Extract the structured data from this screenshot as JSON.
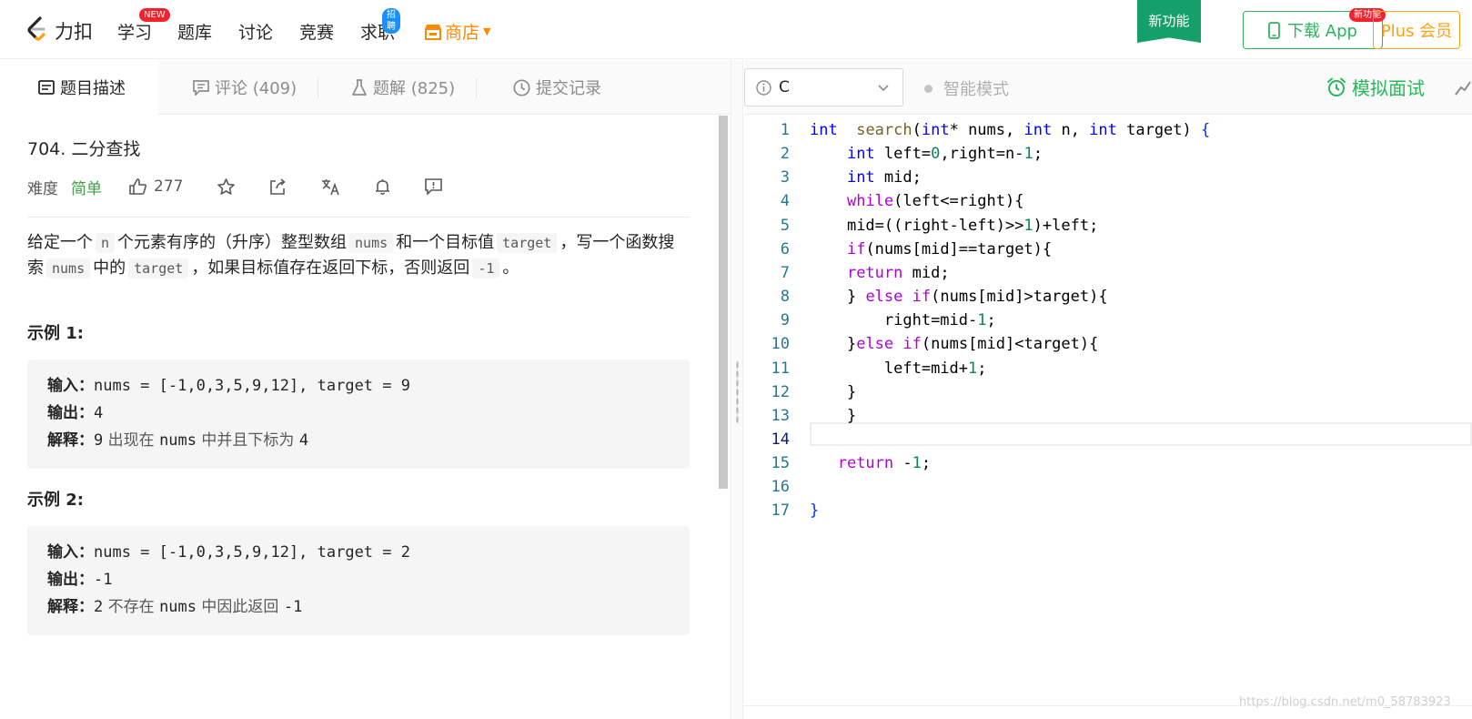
{
  "nav": {
    "logo_text": "力扣",
    "items": [
      {
        "label": "学习",
        "badge": "NEW"
      },
      {
        "label": "题库"
      },
      {
        "label": "讨论"
      },
      {
        "label": "竞赛"
      },
      {
        "label": "求职",
        "badge": "招聘"
      },
      {
        "label": "商店"
      }
    ],
    "new_feature_banner": "新功能",
    "download_label": "下载 App",
    "download_badge": "新功能",
    "plus_label": "Plus 会员"
  },
  "tabs": {
    "description": "题目描述",
    "comments": "评论 (409)",
    "solutions": "题解 (825)",
    "submissions": "提交记录"
  },
  "problem": {
    "title": "704. 二分查找",
    "difficulty_label": "难度",
    "difficulty": "简单",
    "likes": "277",
    "description": {
      "p1": "给定一个",
      "c1": "n",
      "p2": "个元素有序的（升序）整型数组",
      "c2": "nums",
      "p3": "和一个目标值",
      "c3": "target",
      "p4": "，写一个函数搜索",
      "c4": "nums",
      "p5": "中的",
      "c5": "target",
      "p6": "，如果目标值存在返回下标，否则返回",
      "c6": "-1",
      "p7": "。"
    },
    "examples": [
      {
        "title": "示例 1:",
        "input_label": "输入：",
        "input": "nums = [-1,0,3,5,9,12], target = 9",
        "output_label": "输出：",
        "output": "4",
        "explain_label": "解释：",
        "explain": [
          "9",
          " 出现在 ",
          "nums",
          " 中并且下标为 ",
          "4"
        ]
      },
      {
        "title": "示例 2:",
        "input_label": "输入：",
        "input": "nums = [-1,0,3,5,9,12], target = 2",
        "output_label": "输出：",
        "output": "-1",
        "explain_label": "解释：",
        "explain": [
          "2",
          " 不存在 ",
          "nums",
          " 中因此返回 ",
          "-1"
        ]
      }
    ]
  },
  "editor": {
    "language": "C",
    "smart_mode": "智能模式",
    "mock_interview": "模拟面试",
    "current_line": 14,
    "lines": [
      {
        "n": 1,
        "indent": "",
        "tokens": [
          [
            "kw",
            "int"
          ],
          [
            "",
            "  "
          ],
          [
            "fn",
            "search"
          ],
          [
            "",
            "("
          ],
          [
            "kw",
            "int"
          ],
          [
            "",
            "* nums, "
          ],
          [
            "kw",
            "int"
          ],
          [
            "",
            " n, "
          ],
          [
            "kw",
            "int"
          ],
          [
            "",
            " target) "
          ],
          [
            "par",
            "{"
          ]
        ]
      },
      {
        "n": 2,
        "indent": "    ",
        "tokens": [
          [
            "kw",
            "int"
          ],
          [
            "",
            " left="
          ],
          [
            "num",
            "0"
          ],
          [
            "",
            ",right=n-"
          ],
          [
            "num",
            "1"
          ],
          [
            "",
            ";"
          ]
        ]
      },
      {
        "n": 3,
        "indent": "    ",
        "tokens": [
          [
            "kw",
            "int"
          ],
          [
            "",
            " mid;"
          ]
        ]
      },
      {
        "n": 4,
        "indent": "    ",
        "tokens": [
          [
            "ctl",
            "while"
          ],
          [
            "",
            "(left<=right){"
          ]
        ]
      },
      {
        "n": 5,
        "indent": "    ",
        "tokens": [
          [
            "",
            "mid=((right-left)>>"
          ],
          [
            "num",
            "1"
          ],
          [
            "",
            ")+left;"
          ]
        ]
      },
      {
        "n": 6,
        "indent": "    ",
        "tokens": [
          [
            "ctl",
            "if"
          ],
          [
            "",
            "(nums[mid]==target){"
          ]
        ]
      },
      {
        "n": 7,
        "indent": "    ",
        "tokens": [
          [
            "ctl",
            "return"
          ],
          [
            "",
            " mid;"
          ]
        ]
      },
      {
        "n": 8,
        "indent": "    ",
        "tokens": [
          [
            "",
            "} "
          ],
          [
            "ctl",
            "else"
          ],
          [
            "",
            " "
          ],
          [
            "ctl",
            "if"
          ],
          [
            "",
            "(nums[mid]>target){"
          ]
        ]
      },
      {
        "n": 9,
        "indent": "        ",
        "tokens": [
          [
            "",
            "right=mid-"
          ],
          [
            "num",
            "1"
          ],
          [
            "",
            ";"
          ]
        ]
      },
      {
        "n": 10,
        "indent": "    ",
        "tokens": [
          [
            "",
            "}"
          ],
          [
            "ctl",
            "else"
          ],
          [
            "",
            " "
          ],
          [
            "ctl",
            "if"
          ],
          [
            "",
            "(nums[mid]<target){"
          ]
        ]
      },
      {
        "n": 11,
        "indent": "        ",
        "tokens": [
          [
            "",
            "left=mid+"
          ],
          [
            "num",
            "1"
          ],
          [
            "",
            ";"
          ]
        ]
      },
      {
        "n": 12,
        "indent": "    ",
        "tokens": [
          [
            "",
            "}"
          ]
        ]
      },
      {
        "n": 13,
        "indent": "    ",
        "tokens": [
          [
            "",
            "}"
          ]
        ]
      },
      {
        "n": 14,
        "indent": "",
        "tokens": []
      },
      {
        "n": 15,
        "indent": "   ",
        "tokens": [
          [
            "ctl",
            "return"
          ],
          [
            "",
            " -"
          ],
          [
            "num",
            "1"
          ],
          [
            "",
            ";"
          ]
        ]
      },
      {
        "n": 16,
        "indent": "",
        "tokens": []
      },
      {
        "n": 17,
        "indent": "",
        "tokens": [
          [
            "par",
            "}"
          ]
        ]
      }
    ]
  },
  "watermark": "https://blog.csdn.net/m0_58783923",
  "colors": {
    "accent_green": "#2db55d",
    "easy_green": "#43a047",
    "store_orange": "#ff8a00",
    "plus_orange": "#ffa116",
    "badge_red": "#f5222d",
    "badge_blue": "#1a90ff"
  },
  "icons": [
    "leetcode-logo-icon",
    "store-icon",
    "phone-icon",
    "description-icon",
    "comment-icon",
    "flask-icon",
    "clock-icon",
    "thumbs-up-icon",
    "star-icon",
    "share-icon",
    "translate-icon",
    "bell-icon",
    "feedback-icon",
    "info-icon",
    "chevron-down-icon",
    "alarm-clock-icon"
  ]
}
